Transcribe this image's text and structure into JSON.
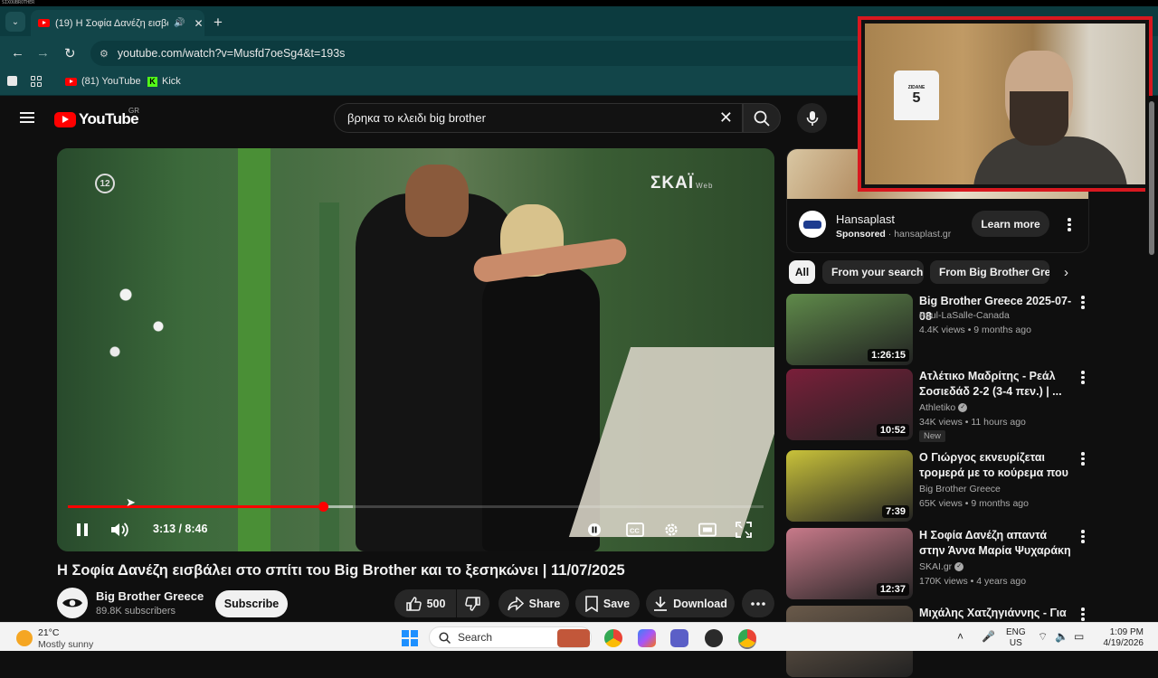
{
  "brand_strip": "SIXOUBROTHER",
  "browser": {
    "tab_title": "(19) Η Σοφία Δανέζη εισβάλ",
    "url": "youtube.com/watch?v=Musfd7oeSg4&t=193s",
    "bookmarks": [
      {
        "label": "(81) YouTube"
      },
      {
        "label": "Kick"
      }
    ]
  },
  "youtube": {
    "logo_word": "YouTube",
    "region": "GR",
    "search_query": "βρηκα το κλειδι big brother"
  },
  "player": {
    "channel_badge": "12",
    "broadcaster": "ΣΚΑΪ",
    "broadcaster_small": "Web",
    "time": "3:13 / 8:46",
    "progress_played": 0.367,
    "progress_buffered": 0.41
  },
  "video": {
    "title": "Η Σοφία Δανέζη εισβάλει στο σπίτι του Big Brother και το ξεσηκώνει | 11/07/2025",
    "channel": "Big Brother Greece",
    "subscribers": "89.8K subscribers",
    "subscribe_label": "Subscribe",
    "likes": "500",
    "share_label": "Share",
    "save_label": "Save",
    "download_label": "Download"
  },
  "ad": {
    "name": "Hansaplast",
    "sponsored": "Sponsored",
    "domain": "hansaplast.gr",
    "cta": "Learn more"
  },
  "chips": [
    "All",
    "From your search",
    "From Big Brother Greece"
  ],
  "recommendations": [
    {
      "title": "Big Brother Greece 2025-07-08",
      "channel": "Paul-LaSalle-Canada",
      "meta": "4.4K views • 9 months ago",
      "duration": "1:26:15",
      "verified": false,
      "new": false,
      "thumb": "#5f8a4a"
    },
    {
      "title": "Ατλέτικο Μαδρίτης - Ρεάλ Σοσιεδάδ 2-2 (3-4 πεν.) | ...",
      "channel": "Athletiko",
      "meta": "34K views • 11 hours ago",
      "duration": "10:52",
      "verified": true,
      "new": true,
      "new_label": "New",
      "thumb": "#7a1f3a"
    },
    {
      "title": "Ο Γιώργος εκνευρίζεται τρομερά με το κούρεμα που ...",
      "channel": "Big Brother Greece",
      "meta": "65K views • 9 months ago",
      "duration": "7:39",
      "verified": false,
      "new": false,
      "thumb": "#c9c23a"
    },
    {
      "title": "Η Σοφία Δανέζη απαντά στην Άννα Μαρία Ψυχαράκη | Love i...",
      "channel": "SKAI.gr",
      "meta": "170K views • 4 years ago",
      "duration": "12:37",
      "verified": true,
      "new": false,
      "thumb": "#c87a8a"
    },
    {
      "title": "Μιχάλης Χατζηγιάννης - Για",
      "channel": "",
      "meta": "",
      "duration": "",
      "verified": false,
      "new": false,
      "thumb": "#6a5a4a"
    }
  ],
  "webcam": {
    "jersey_name": "ZIDANE",
    "jersey_number": "5"
  },
  "taskbar": {
    "temperature": "21°C",
    "weather": "Mostly sunny",
    "search_label": "Search",
    "lang_1": "ENG",
    "lang_2": "US",
    "time": "1:09 PM",
    "date": "4/19/2026"
  },
  "colors": {
    "youtube_red": "#ff0000",
    "browser_teal": "#124549",
    "webcam_border": "#d8181f"
  }
}
